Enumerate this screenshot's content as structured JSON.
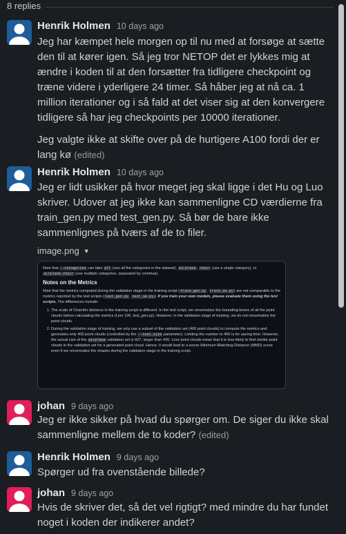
{
  "thread": {
    "replies_count": "8 replies"
  },
  "messages": [
    {
      "author": "Henrik Holmen",
      "time": "10 days ago",
      "avatar": "person-avatar-blue",
      "paragraphs": [
        "Jeg har kæmpet hele morgen op til nu med at forsøge at sætte den til at kører igen. Så jeg tror NETOP det er lykkes mig at ændre i koden til at den forsætter fra tidligere checkpoint og træne videre i yderligere 24 timer. Så håber jeg at nå ca. 1 million iterationer og i så fald at det viser sig at den konvergere tidligere så har jeg checkpoints per 10000 iterationer.",
        "Jeg valgte ikke at skifte over på de hurtigere A100 fordi der er lang kø"
      ],
      "edited": "(edited)"
    },
    {
      "author": "Henrik Holmen",
      "time": "10 days ago",
      "avatar": "person-avatar-blue",
      "text": "Jeg er lidt usikker på hvor meget jeg skal ligge i det Hu og Luo skriver. Udover at jeg ikke kan sammenligne CD værdierne fra train_gen.py med test_gen.py. Så bør de bare ikke sammenlignes på tværs af de to filer.",
      "attachment": {
        "filename": "image.png",
        "intro_prefix": "Note that",
        "intro_code1": "--categories",
        "intro_mid1": "can take",
        "intro_code2": "all",
        "intro_mid2": "(use all the categories in the dataset),",
        "intro_code3": "airplane",
        "intro_code4": "chair",
        "intro_mid3": "(use a single category), or",
        "intro_code5": "airplane,chair",
        "intro_suffix": "(use multiple categories, separated by commas).",
        "heading": "Notes on the Metrics",
        "para_a": "Note that the metrics computed during the validation stage in the training script (",
        "para_code1": "train_gen.py",
        "para_code2": "train_ae.py",
        "para_b": ") are not comparable to the metrics reported by the test scripts (",
        "para_code3": "test_gen.py",
        "para_code4": "test_ae.py",
        "para_c": "). If you train your own models, please evaluate them using the test scripts.",
        "para_d": "The differences include:",
        "item1": "The scale of Chamfer distance in the training script is different. In the test script, we renormalize the bounding boxes of all the point clouds before calculating the metrics (Line 100, test_gen.py). However, in the validation stage of training, we do not renormalize the point clouds.",
        "item2_a": "During the validation stage of training, we only use a subset of the validation set (400 point clouds) to compute the metrics and generates only 400 point clouds (controlled by the",
        "item2_code1": "--test_size",
        "item2_b": "parameter). Limiting the number to 400 is for saving time. However, the actual size of the",
        "item2_code2": "airplane",
        "item2_c": "validation set is 607, larger than 400. Less point clouds mean that it is less likely to find similar point clouds in the validation set for a generated point cloud. Hence, it would lead to a worse Minimum-Matching-Distance (MMD) score even if we renormalize the shapes during the validation stage in the training script."
      }
    },
    {
      "author": "johan",
      "time": "9 days ago",
      "avatar": "person-avatar-red",
      "text": "Jeg er ikke sikker på hvad du spørger om. De siger du ikke skal sammenligne mellem de to koder?",
      "edited": "(edited)"
    },
    {
      "author": "Henrik Holmen",
      "time": "9 days ago",
      "avatar": "person-avatar-blue",
      "text": "Spørger ud fra ovenstående billede?"
    },
    {
      "author": "johan",
      "time": "9 days ago",
      "avatar": "person-avatar-red",
      "text": "Hvis de skriver det, så det vel rigtigt? med mindre du har fundet noget i koden der indikerer andet?"
    }
  ],
  "colors": {
    "background": "#1a1d21",
    "avatar_blue": "#1d5d99",
    "avatar_red": "#e01e5a",
    "text": "#d1d2d3"
  }
}
